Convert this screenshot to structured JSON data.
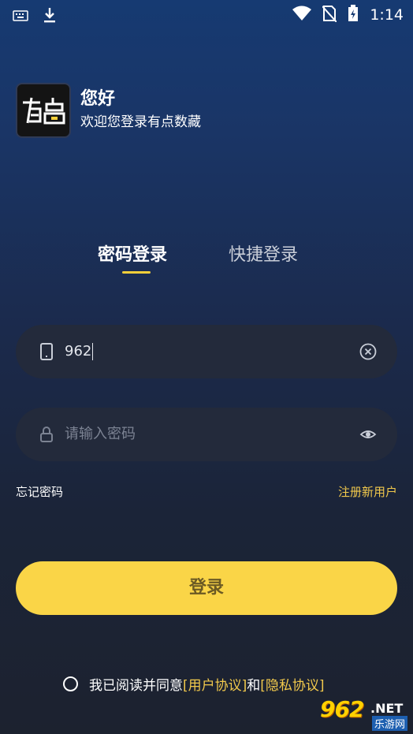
{
  "status_bar": {
    "time": "1:14",
    "icons": [
      "keyboard-icon",
      "download-icon",
      "wifi-icon",
      "no-sim-icon",
      "battery-icon"
    ]
  },
  "header": {
    "logo_text": "有点",
    "title": "您好",
    "subtitle": "欢迎您登录有点数藏"
  },
  "tabs": [
    {
      "label": "密码登录",
      "active": true
    },
    {
      "label": "快捷登录",
      "active": false
    }
  ],
  "phone_field": {
    "value": "962",
    "icon": "phone-icon",
    "action_icon": "clear-icon"
  },
  "password_field": {
    "placeholder": "请输入密码",
    "icon": "lock-icon",
    "action_icon": "eye-icon"
  },
  "links": {
    "forgot": "忘记密码",
    "register": "注册新用户"
  },
  "login_button": {
    "label": "登录"
  },
  "agreement": {
    "text_before": "我已阅读并同意",
    "user_agreement": "[用户协议]",
    "and": "和",
    "privacy": "[隐私协议]",
    "checked": false
  },
  "watermark": {
    "number": "962",
    "suffix": ".NET",
    "site": "乐游网"
  },
  "colors": {
    "accent": "#fad547",
    "link": "#f2c94c",
    "field_bg": "#232a3b"
  }
}
